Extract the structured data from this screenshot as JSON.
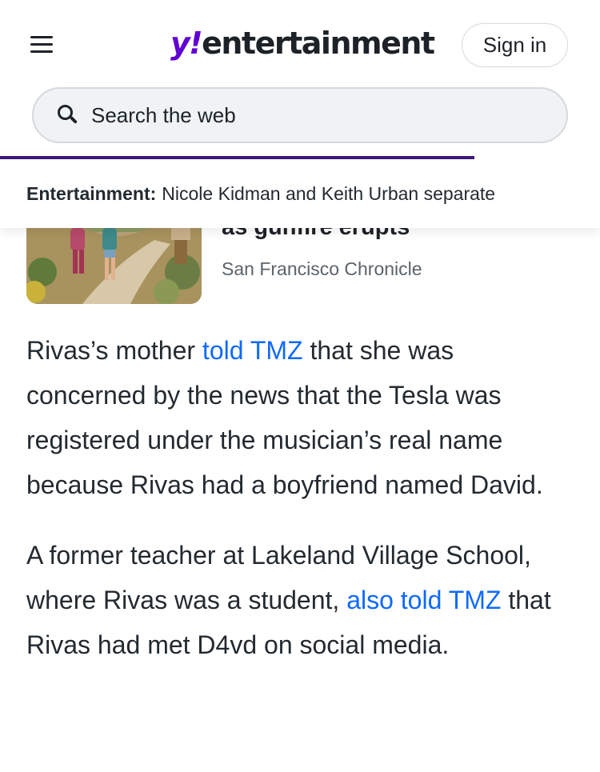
{
  "header": {
    "menu_icon": "hamburger-menu-icon",
    "logo_mark": "y!",
    "logo_word": "entertainment",
    "signin_label": "Sign in",
    "brand_color": "#6001d2"
  },
  "search": {
    "icon": "search-icon",
    "placeholder": "Search the web"
  },
  "progress": {
    "fraction": 0.79,
    "color": "#3c1a78"
  },
  "trending": {
    "label": "Entertainment:",
    "text": "Nicole Kidman and Keith Urban separate"
  },
  "related_story": {
    "title": "as gunfire erupts",
    "source": "San Francisco Chronicle"
  },
  "article": {
    "p1_before": "Rivas’s mother ",
    "p1_link": "told TMZ",
    "p1_after": " that she was concerned by the news that the Tesla was registered under the musician’s real name because Rivas had a boyfriend named David.",
    "p2_before": "A former teacher at Lakeland Village School, where Rivas was a student, ",
    "p2_link": "also told TMZ",
    "p2_after": " that Rivas had met D4vd on social media.",
    "link_color": "#0f69ff"
  }
}
